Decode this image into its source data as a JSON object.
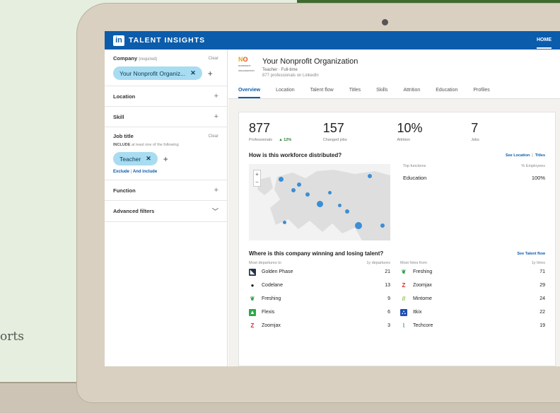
{
  "background": {
    "left_text": "orts"
  },
  "app": {
    "title": "TALENT INSIGHTS",
    "logo": "in",
    "home": "HOME"
  },
  "sidebar": {
    "company": {
      "label": "Company",
      "required": "(required)",
      "clear": "Clear",
      "pill": "Your Nonprofit Organiz...",
      "plus": "+"
    },
    "location": {
      "label": "Location",
      "plus": "+"
    },
    "skill": {
      "label": "Skill",
      "plus": "+"
    },
    "job_title": {
      "label": "Job title",
      "clear": "Clear",
      "hint_bold": "INCLUDE",
      "hint": "at least one of the following",
      "pill": "Teacher",
      "plus": "+",
      "exclude": "Exclude",
      "sep": "|",
      "and_include": "And include"
    },
    "function": {
      "label": "Function",
      "plus": "+"
    },
    "advanced": {
      "label": "Advanced filters"
    }
  },
  "org": {
    "logo_n": "N",
    "logo_o": "O",
    "logo_sub": "NONPROFIT ORGANIZATION",
    "name": "Your Nonprofit Organization",
    "meta": "Teacher · Full-time",
    "sub": "877 professionals on LinkedIn"
  },
  "tabs": [
    "Overview",
    "Location",
    "Talent flow",
    "Titles",
    "Skills",
    "Attrition",
    "Education",
    "Profiles"
  ],
  "stats": [
    {
      "value": "877",
      "label": "Professionals",
      "delta": "▲ 12%"
    },
    {
      "value": "157",
      "label": "Changed jobs",
      "delta": ""
    },
    {
      "value": "10%",
      "label": "Attrition",
      "delta": ""
    },
    {
      "value": "7",
      "label": "Jobs",
      "delta": ""
    }
  ],
  "distribution": {
    "title": "How is this workforce distributed?",
    "link1": "See Location",
    "link_sep": "|",
    "link2": "Titles",
    "zoom_in": "+",
    "zoom_out": "−",
    "func_header": "Top functions",
    "pct_header": "% Employees",
    "functions": [
      {
        "name": "Education",
        "pct": "100%"
      }
    ]
  },
  "talent": {
    "title": "Where is this company winning and losing talent?",
    "link": "See Talent flow",
    "col1": "Most departures to",
    "col2": "1y departures",
    "col3": "Most hires from",
    "col4": "1y hires",
    "rows": [
      {
        "dep_name": "Golden Phase",
        "dep_icon": "golden-phase-icon",
        "dep_val": "21",
        "hire_name": "Freshing",
        "hire_icon": "freshing-icon",
        "hire_val": "71"
      },
      {
        "dep_name": "Codelane",
        "dep_icon": "codelane-icon",
        "dep_val": "13",
        "hire_name": "Zoomjax",
        "hire_icon": "zoomjax-icon",
        "hire_val": "29"
      },
      {
        "dep_name": "Freshing",
        "dep_icon": "freshing-icon",
        "dep_val": "9",
        "hire_name": "Mintome",
        "hire_icon": "mintome-icon",
        "hire_val": "24"
      },
      {
        "dep_name": "Flexis",
        "dep_icon": "flexis-icon",
        "dep_val": "6",
        "hire_name": "Itkix",
        "hire_icon": "itkix-icon",
        "hire_val": "22"
      },
      {
        "dep_name": "Zoomjax",
        "dep_icon": "zoomjax-icon",
        "dep_val": "3",
        "hire_name": "Techcore",
        "hire_icon": "techcore-icon",
        "hire_val": "19"
      }
    ]
  },
  "colors": {
    "brand": "#0b5cab",
    "pill": "#a8dcf1",
    "map_dot": "#3a8ed6",
    "delta": "#2e7d32"
  }
}
